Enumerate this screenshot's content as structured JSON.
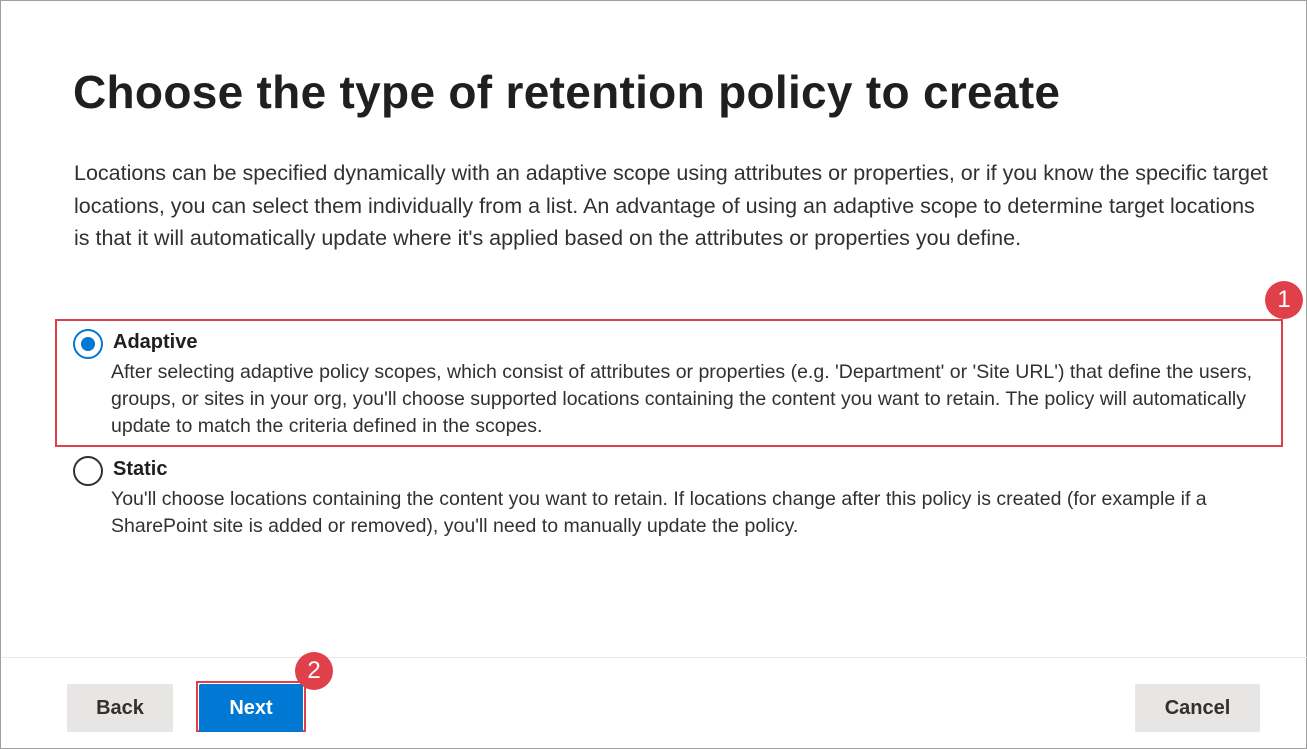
{
  "page": {
    "title": "Choose the type of retention policy to create",
    "intro": "Locations can be specified dynamically with an adaptive scope using attributes or properties, or if you know the specific target locations, you can select them individually from a list. An advantage of using an adaptive scope to determine target locations is that it will automatically update where it's applied based on the attributes or properties you define."
  },
  "options": [
    {
      "label": "Adaptive",
      "description": "After selecting adaptive policy scopes, which consist of attributes or properties (e.g. 'Department' or 'Site URL') that define the users, groups, or sites in your org, you'll choose supported locations containing the content you want to retain. The policy will automatically update to match the criteria defined in the scopes.",
      "selected": true
    },
    {
      "label": "Static",
      "description": "You'll choose locations containing the content you want to retain. If locations change after this policy is created (for example if a SharePoint site is added or removed), you'll need to manually update the policy.",
      "selected": false
    }
  ],
  "annotations": {
    "step1": "1",
    "step2": "2"
  },
  "footer": {
    "back_label": "Back",
    "next_label": "Next",
    "cancel_label": "Cancel"
  },
  "colors": {
    "accent": "#0078d4",
    "annotation": "#e0404a"
  }
}
